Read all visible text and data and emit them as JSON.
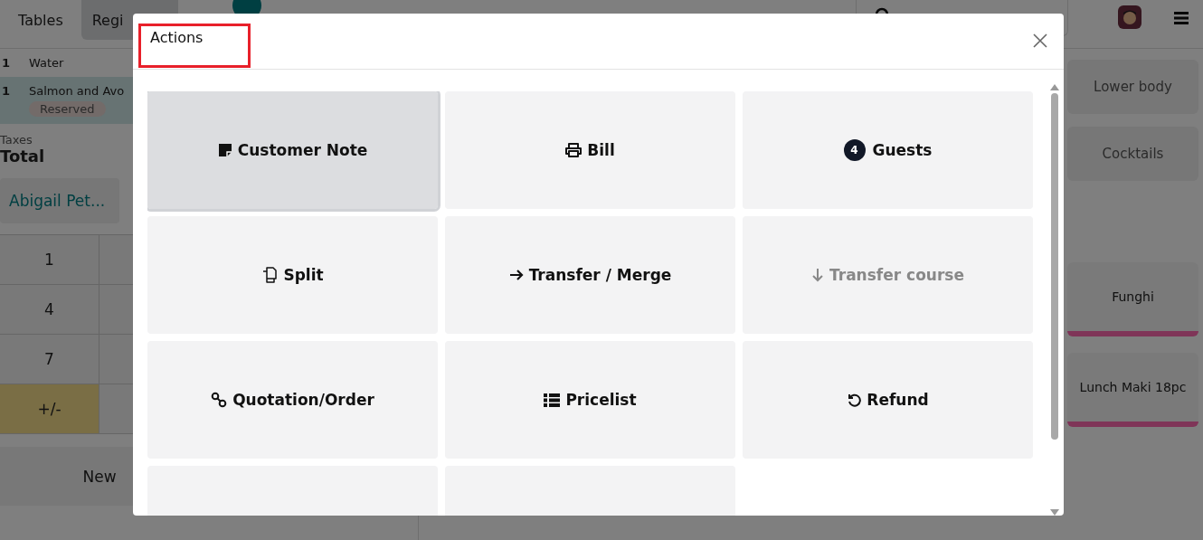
{
  "top_bar": {
    "tabs": [
      {
        "label": "Tables",
        "selected": false
      },
      {
        "label": "Regi",
        "selected": true
      }
    ]
  },
  "order_lines": [
    {
      "qty": "1",
      "name": "Water",
      "selected": false
    },
    {
      "qty": "1",
      "name": "Salmon and Avo",
      "selected": true,
      "tag": "Reserved"
    }
  ],
  "totals": {
    "taxes_label": "Taxes",
    "total_label": "Total"
  },
  "customer_button": "Abigail Pet...",
  "numpad": [
    {
      "label": "1",
      "kind": "digit"
    },
    {
      "label": "4",
      "kind": "digit"
    },
    {
      "label": "7",
      "kind": "digit"
    },
    {
      "label": "+/-",
      "kind": "sign"
    }
  ],
  "new_button": "New",
  "categories": [
    "Lower body",
    "Cocktails"
  ],
  "products": [
    {
      "name": "Funghi",
      "color": "#7f3558"
    },
    {
      "name": "Lunch Maki 18pc",
      "color": "#7f3558"
    }
  ],
  "dialog": {
    "title": "Actions",
    "title_highlighted": true,
    "actions": [
      {
        "label": "Customer Note",
        "kind": "note",
        "selected": true,
        "disabled": false
      },
      {
        "label": "Bill",
        "kind": "print",
        "selected": false,
        "disabled": false
      },
      {
        "label": "Guests",
        "kind": "guests",
        "badge": "4",
        "selected": false,
        "disabled": false
      },
      {
        "label": "Split",
        "kind": "split",
        "selected": false,
        "disabled": false
      },
      {
        "label": "Transfer / Merge",
        "kind": "transfer",
        "selected": false,
        "disabled": false
      },
      {
        "label": "Transfer course",
        "kind": "course",
        "selected": false,
        "disabled": true
      },
      {
        "label": "Quotation/Order",
        "kind": "link",
        "selected": false,
        "disabled": false
      },
      {
        "label": "Pricelist",
        "kind": "list",
        "selected": false,
        "disabled": false
      },
      {
        "label": "Refund",
        "kind": "refund",
        "selected": false,
        "disabled": false
      }
    ]
  }
}
